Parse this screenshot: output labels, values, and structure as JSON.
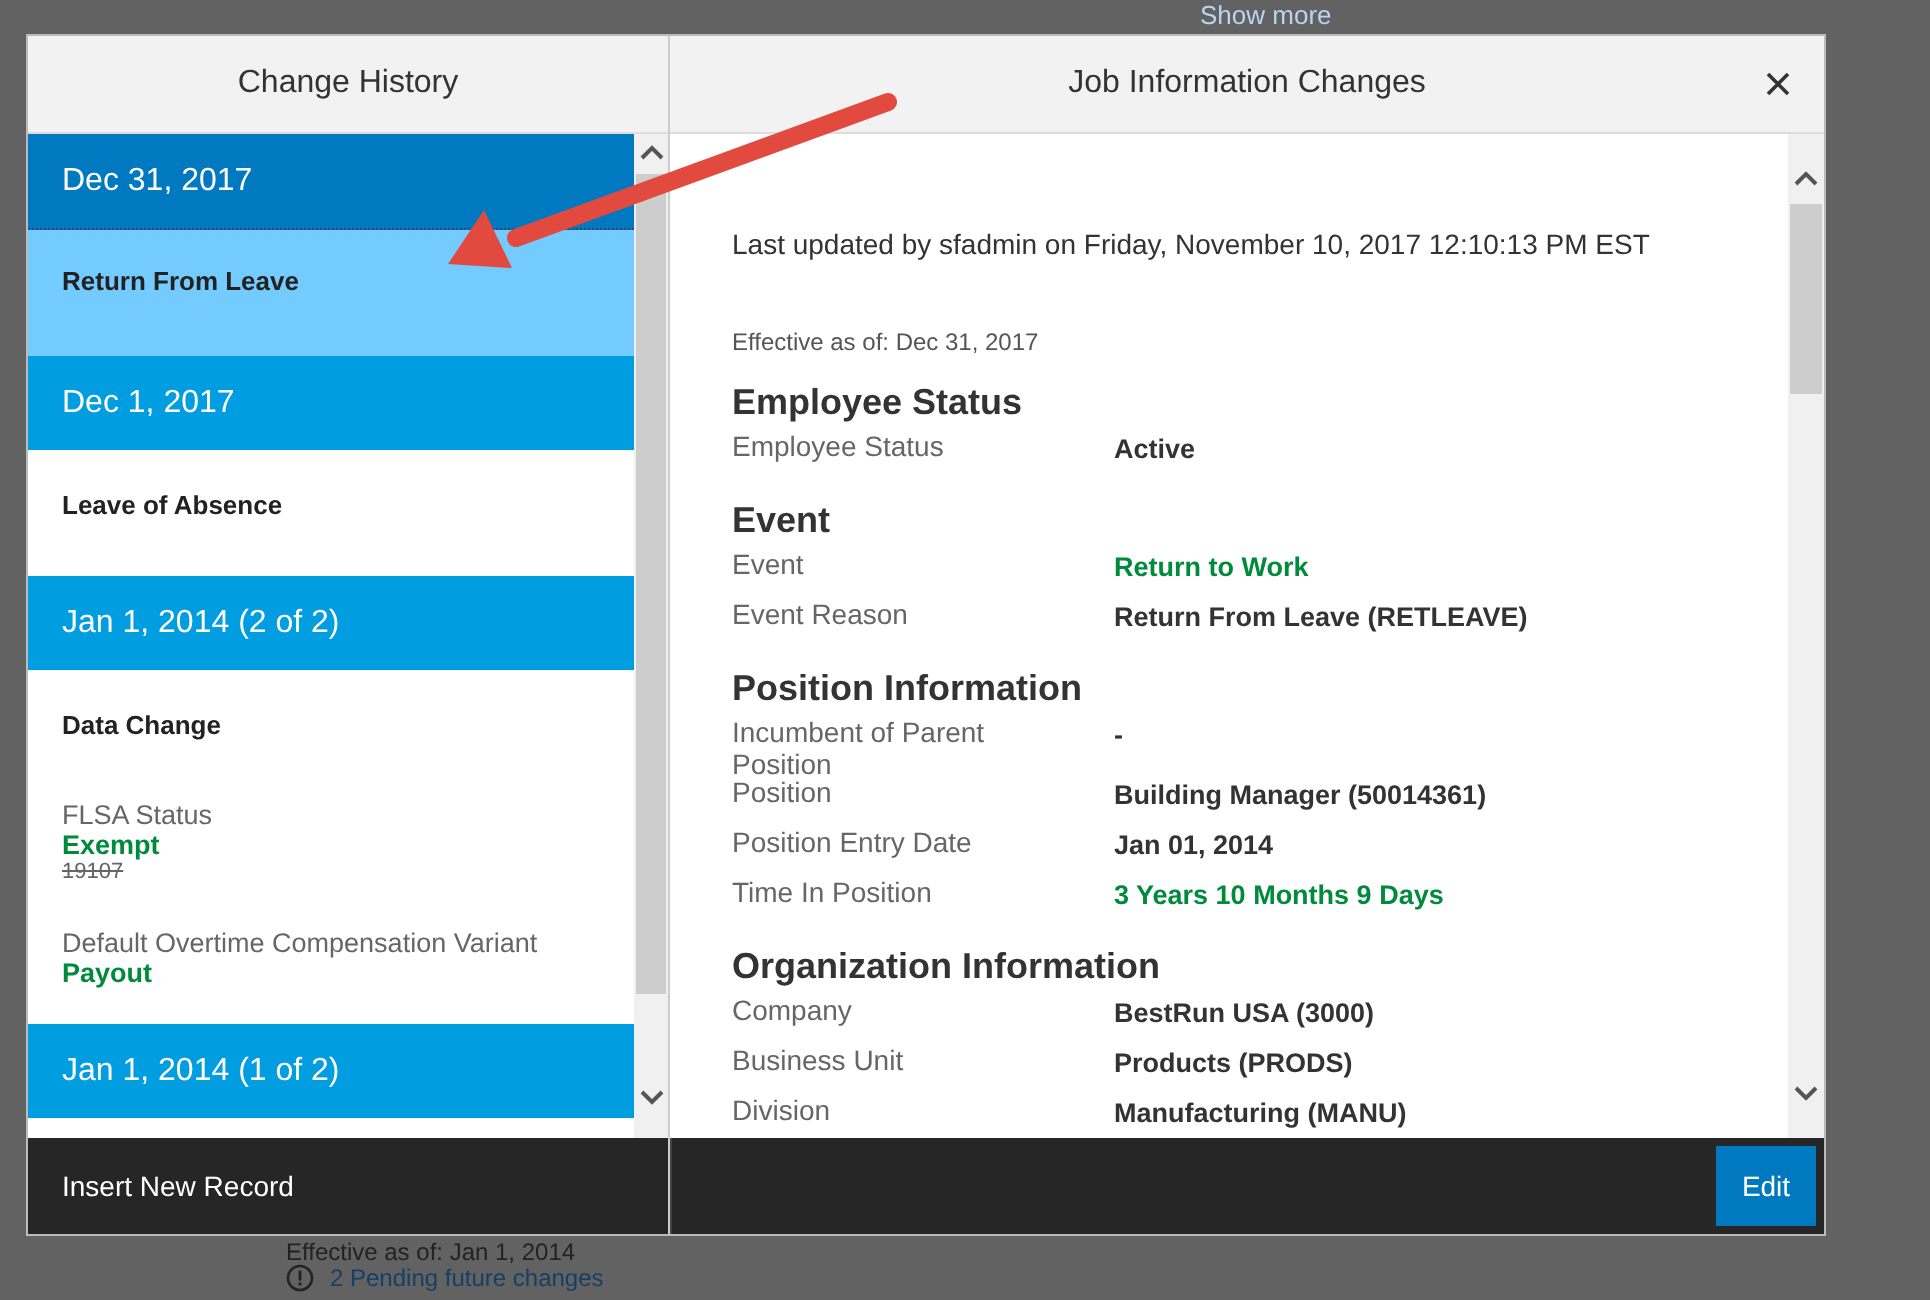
{
  "background_page": {
    "show_more_link": "Show more",
    "effective_note": "Effective as of: Jan 1, 2014",
    "pending_link": "2 Pending future changes"
  },
  "dialog": {
    "history_title": "Change History",
    "detail_title": "Job Information Changes",
    "history": [
      {
        "date": "Dec 31, 2017",
        "selected": true,
        "event": "Return From Leave"
      },
      {
        "date": "Dec 1, 2017",
        "selected": false,
        "event": "Leave of Absence"
      },
      {
        "date": "Jan 1, 2014 (2 of 2)",
        "selected": false,
        "event": "Data Change",
        "changes": [
          {
            "label": "FLSA Status",
            "new_value": "Exempt",
            "old_value": "19107"
          },
          {
            "label": "Default Overtime Compensation Variant",
            "new_value": "Payout"
          }
        ]
      },
      {
        "date": "Jan 1, 2014 (1 of 2)",
        "selected": false
      }
    ],
    "insert_button": "Insert New Record",
    "last_updated": "Last updated by sfadmin on Friday, November 10, 2017 12:10:13 PM EST",
    "effective": "Effective as of: Dec 31, 2017",
    "sections": [
      {
        "title": "Employee Status",
        "fields": [
          {
            "label": "Employee Status",
            "value": "Active",
            "changed": false
          }
        ]
      },
      {
        "title": "Event",
        "fields": [
          {
            "label": "Event",
            "value": "Return to Work",
            "changed": true
          },
          {
            "label": "Event Reason",
            "value": "Return From Leave (RETLEAVE)",
            "changed": false
          }
        ]
      },
      {
        "title": "Position Information",
        "fields": [
          {
            "label": "Incumbent of Parent Position",
            "value": "-",
            "changed": false
          },
          {
            "label": "Position",
            "value": "Building Manager (50014361)",
            "changed": false
          },
          {
            "label": "Position Entry Date",
            "value": "Jan 01, 2014",
            "changed": false
          },
          {
            "label": "Time In Position",
            "value": "3 Years 10 Months 9 Days",
            "changed": true
          }
        ]
      },
      {
        "title": "Organization Information",
        "fields": [
          {
            "label": "Company",
            "value": "BestRun USA (3000)",
            "changed": false
          },
          {
            "label": "Business Unit",
            "value": "Products (PRODS)",
            "changed": false
          },
          {
            "label": "Division",
            "value": "Manufacturing (MANU)",
            "changed": false
          }
        ]
      }
    ],
    "edit_button": "Edit"
  }
}
